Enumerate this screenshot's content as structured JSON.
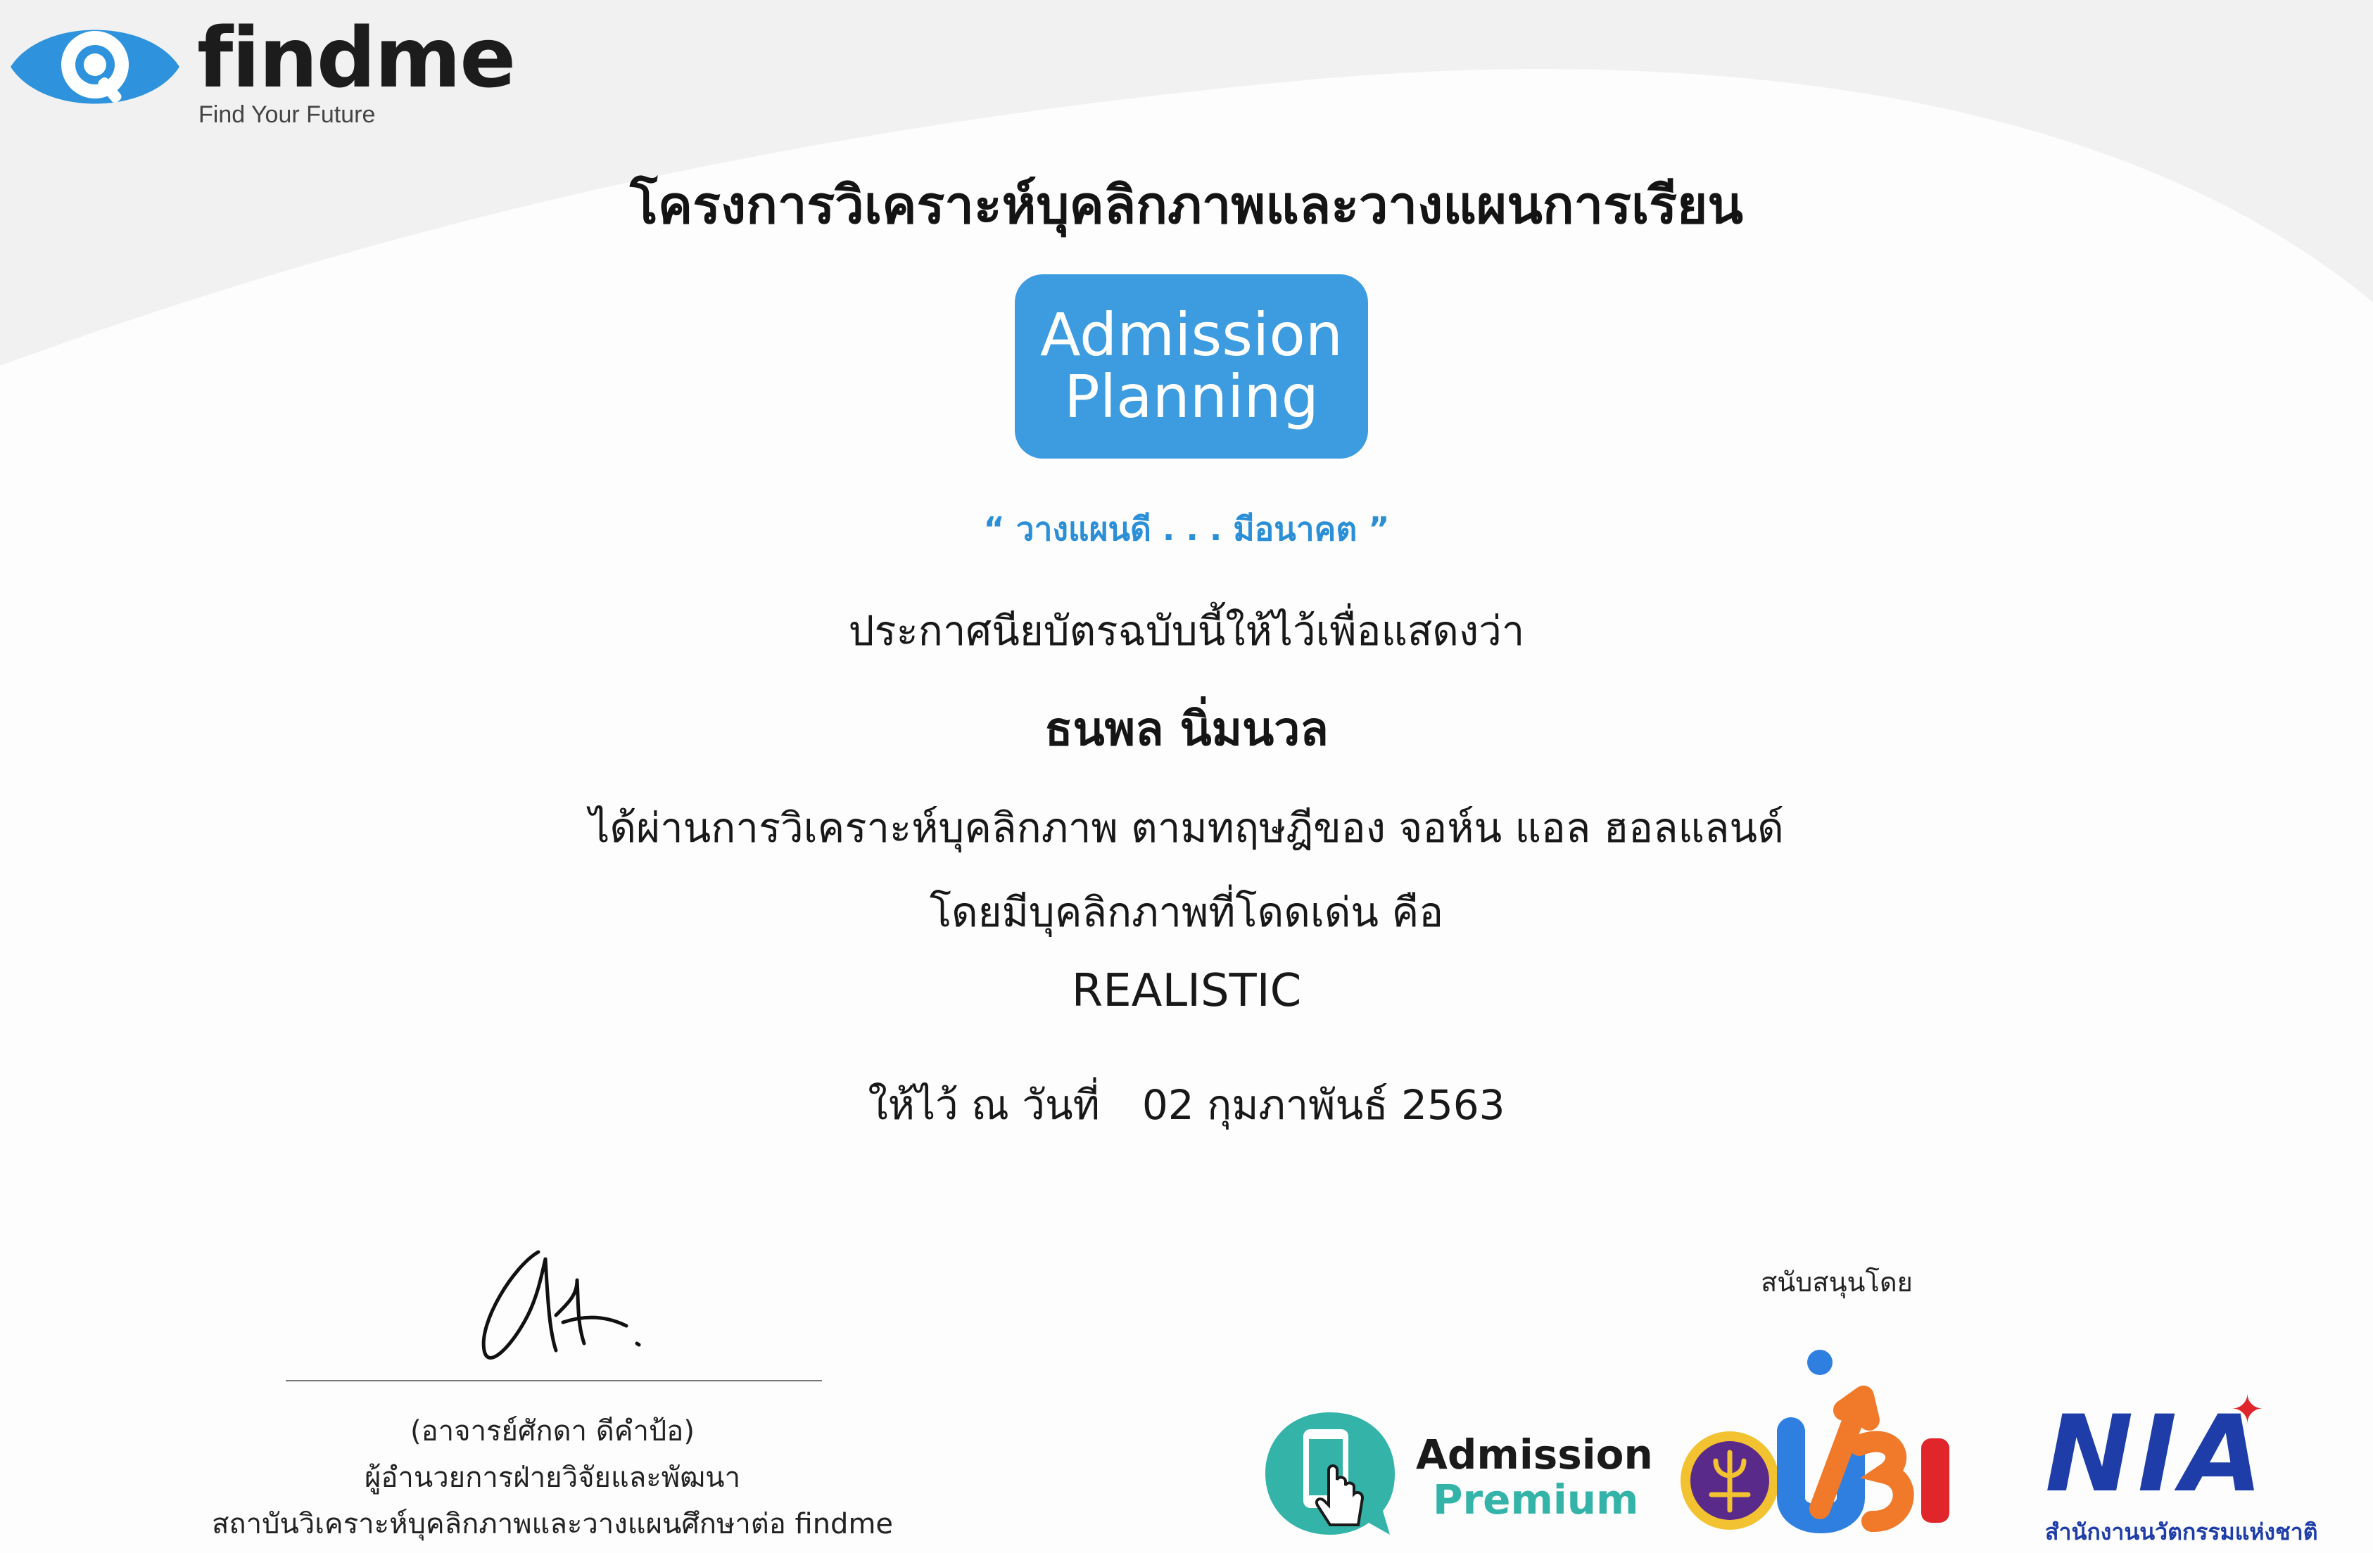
{
  "brand": {
    "name": "findme",
    "tagline": "Find Your Future",
    "primary_color": "#3d9be0",
    "logo_icon": "eye-magnifier-icon"
  },
  "certificate": {
    "title": "โครงการวิเคราะห์บุคลิกภาพและวางแผนการเรียน",
    "badge_line1": "Admission",
    "badge_line2": "Planning",
    "slogan": "“ วางแผนดี . . . มีอนาคต ”",
    "intro": "ประกาศนียบัตรฉบับนี้ให้ไว้เพื่อแสดงว่า",
    "recipient": "ธนพล นิ่มนวล",
    "statement": "ได้ผ่านการวิเคราะห์บุคลิกภาพ ตามทฤษฎีของ จอห์น แอล ฮอลแลนด์",
    "statement2": "โดยมีบุคลิกภาพที่โดดเด่น คือ",
    "result": "REALISTIC",
    "date_label": "ให้ไว้ ณ วันที่",
    "date_value": "02 กุมภาพันธ์ 2563"
  },
  "signatory": {
    "signature_icon": "signature-icon",
    "name": "(อาจารย์ศักดา ดีคำป้อ)",
    "role": "ผู้อำนวยการฝ่ายวิจัยและพัฒนา",
    "organization": "สถาบันวิเคราะห์บุคลิกภาพและวางแผนศึกษาต่อ findme"
  },
  "sponsors": {
    "label": "สนับสนุนโดย",
    "admission_premium": {
      "name": "Admission",
      "sub": "Premium",
      "color": "#34b3a8",
      "icon": "phone-touch-icon"
    },
    "ubi": {
      "emblem_icon": "university-emblem-icon",
      "text": "UBI",
      "colors": [
        "#2f7fe0",
        "#f07a2a",
        "#e0252b"
      ]
    },
    "nia": {
      "name": "NIA",
      "sub": "สำนักงานนวัตกรรมแห่งชาติ",
      "color": "#1e3da8",
      "star_color": "#e0252b"
    }
  }
}
